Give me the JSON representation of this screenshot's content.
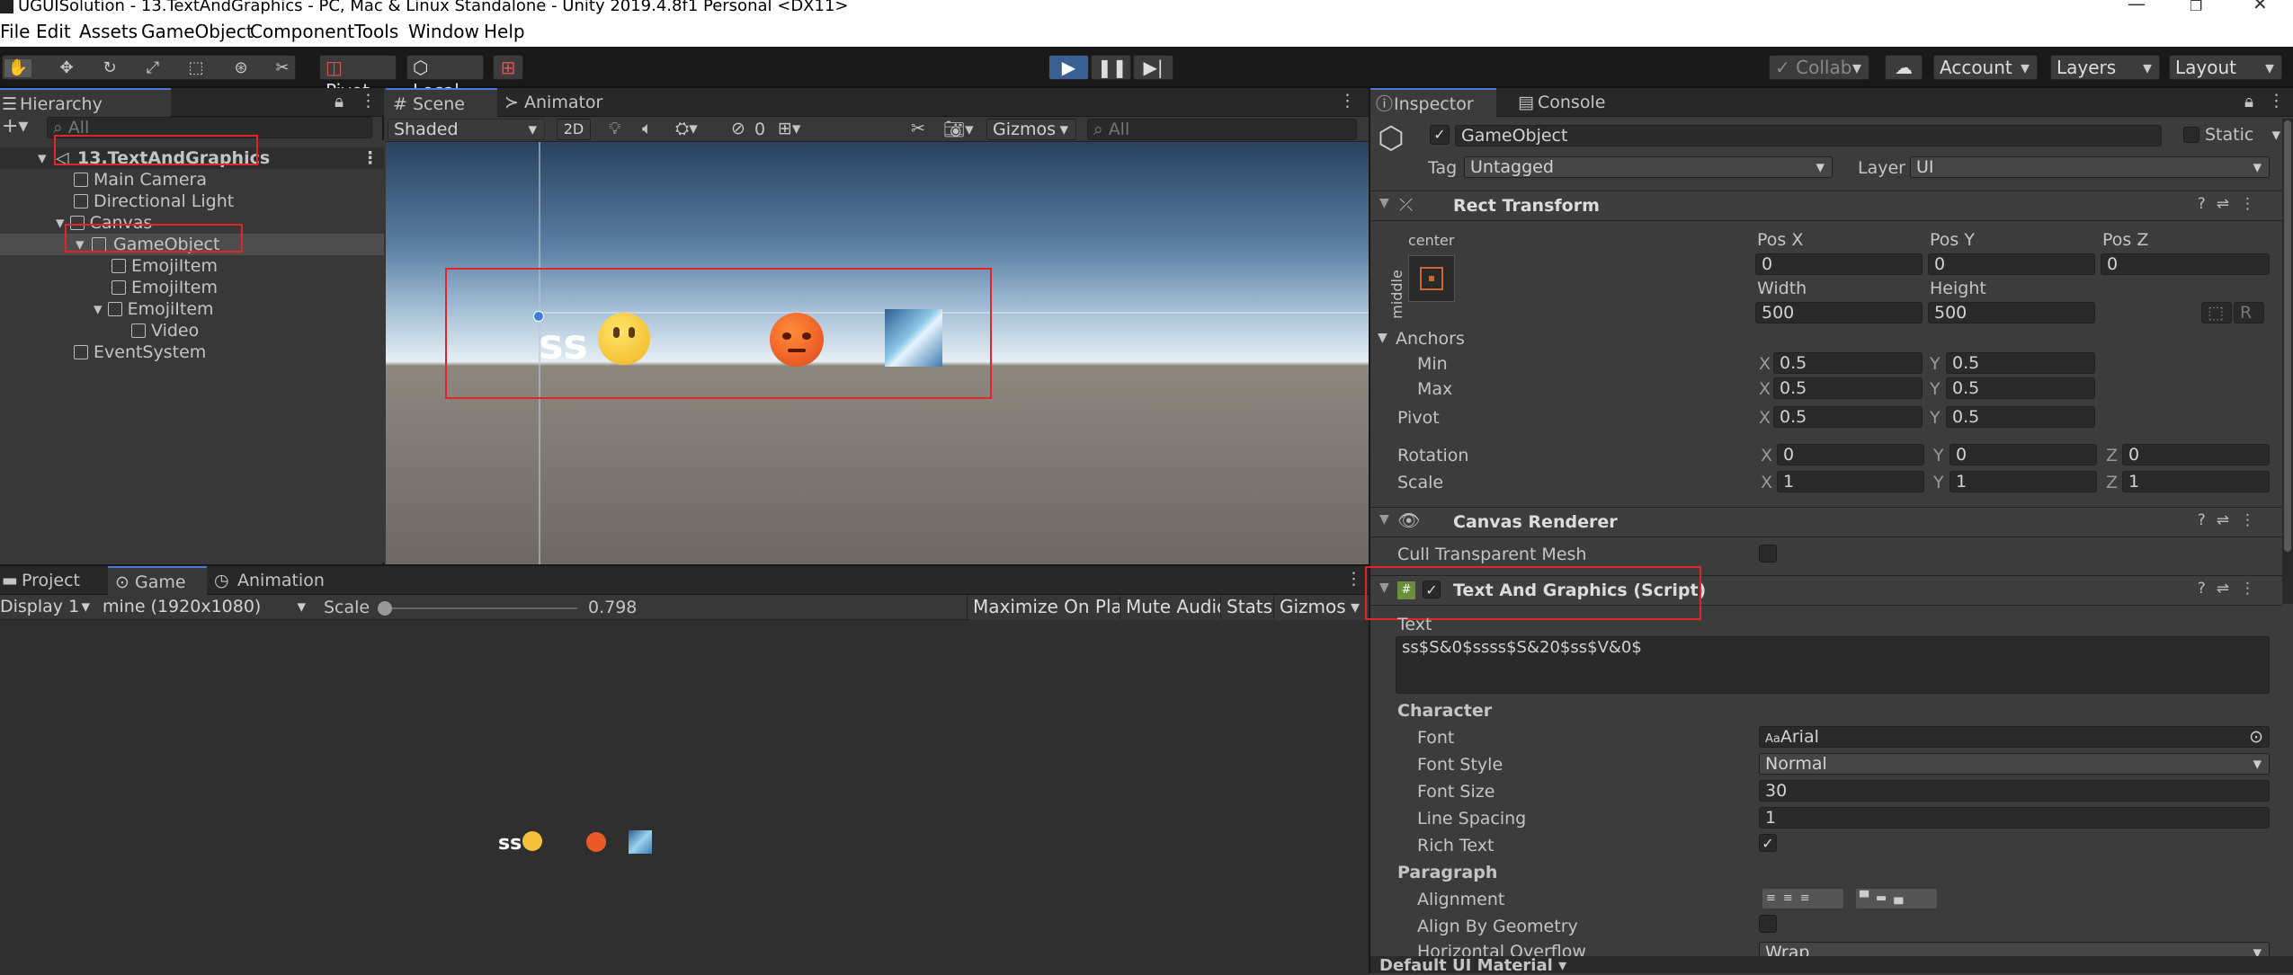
{
  "window": {
    "title": "UGUISolution - 13.TextAndGraphics - PC, Mac & Linux Standalone - Unity 2019.4.8f1 Personal <DX11>"
  },
  "menu": [
    "File",
    "Edit",
    "Assets",
    "GameObject",
    "Component",
    "Tools",
    "Window",
    "Help"
  ],
  "toolbar": {
    "pivot": "Pivot",
    "local": "Local",
    "collab": "Collab",
    "account": "Account",
    "layers": "Layers",
    "layout": "Layout"
  },
  "hierarchy": {
    "tab": "Hierarchy",
    "search_placeholder": "All",
    "items": [
      {
        "label": "13.TextAndGraphics"
      },
      {
        "label": "Main Camera"
      },
      {
        "label": "Directional Light"
      },
      {
        "label": "Canvas"
      },
      {
        "label": "GameObject"
      },
      {
        "label": "EmojiItem"
      },
      {
        "label": "EmojiItem"
      },
      {
        "label": "EmojiItem"
      },
      {
        "label": "Video"
      },
      {
        "label": "EventSystem"
      }
    ]
  },
  "scene": {
    "tabs": [
      "Scene",
      "Animator"
    ],
    "shading": "Shaded",
    "mode_2d": "2D",
    "layer_count": "0",
    "gizmos": "Gizmos",
    "search_placeholder": "All",
    "text_ss": "ss"
  },
  "game": {
    "tabs": [
      "Project",
      "Game",
      "Animation"
    ],
    "display": "Display 1",
    "resolution": "mine (1920x1080)",
    "scale_label": "Scale",
    "scale_value": "0.798",
    "maximize": "Maximize On Play",
    "mute": "Mute Audio",
    "stats": "Stats",
    "gizmos": "Gizmos",
    "text_ss": "ss"
  },
  "inspector": {
    "tabs": [
      "Inspector",
      "Console"
    ],
    "object_name": "GameObject",
    "static_label": "Static",
    "tag_label": "Tag",
    "tag_value": "Untagged",
    "layer_label": "Layer",
    "layer_value": "UI",
    "rect": {
      "title": "Rect Transform",
      "anchor_h": "center",
      "anchor_v": "middle",
      "posx_l": "Pos X",
      "posy_l": "Pos Y",
      "posz_l": "Pos Z",
      "posx": "0",
      "posy": "0",
      "posz": "0",
      "width_l": "Width",
      "height_l": "Height",
      "width": "500",
      "height": "500",
      "anchors": "Anchors",
      "min": "Min",
      "max": "Max",
      "min_x": "0.5",
      "min_y": "0.5",
      "max_x": "0.5",
      "max_y": "0.5",
      "pivot": "Pivot",
      "pivot_x": "0.5",
      "pivot_y": "0.5",
      "rotation": "Rotation",
      "rot_x": "0",
      "rot_y": "0",
      "rot_z": "0",
      "scale": "Scale",
      "sc_x": "1",
      "sc_y": "1",
      "sc_z": "1",
      "x": "X",
      "y": "Y",
      "z": "Z",
      "r": "R"
    },
    "canvas_renderer": {
      "title": "Canvas Renderer",
      "cull": "Cull Transparent Mesh"
    },
    "script": {
      "title": "Text And Graphics (Script)",
      "text_label": "Text",
      "text_value": "ss$S&0$ssss$S&20$ss$V&0$",
      "character": "Character",
      "font_l": "Font",
      "font": "Arial",
      "font_icon": "Aa",
      "font_style_l": "Font Style",
      "font_style": "Normal",
      "font_size_l": "Font Size",
      "font_size": "30",
      "line_spacing_l": "Line Spacing",
      "line_spacing": "1",
      "rich_text_l": "Rich Text",
      "paragraph": "Paragraph",
      "alignment_l": "Alignment",
      "align_geom_l": "Align By Geometry",
      "h_overflow_l": "Horizontal Overflow",
      "h_overflow": "Wrap"
    },
    "material": "Default UI Material"
  }
}
